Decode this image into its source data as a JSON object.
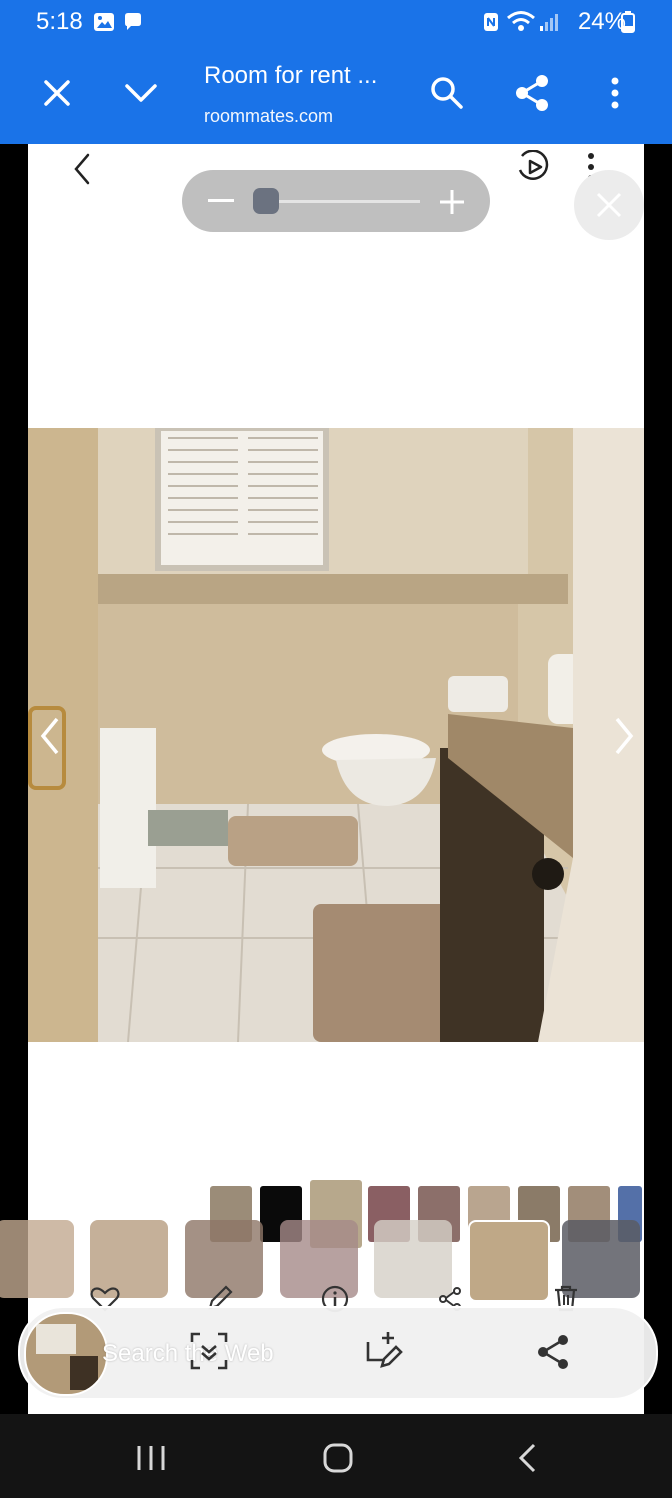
{
  "status_bar": {
    "time": "5:18",
    "battery": "24%"
  },
  "browser": {
    "title": "Room for rent ...",
    "url": "roommates.com"
  },
  "lens": {
    "search_placeholder": "Search the Web"
  },
  "colors": {
    "brand_blue": "#1a73e8",
    "viewer_bg": "#ffffff",
    "nav_bg": "#141414"
  },
  "icons": {
    "status_left": [
      "gallery-icon",
      "chat-icon"
    ],
    "status_right": [
      "nfc-icon",
      "wifi-icon",
      "signal-icon",
      "battery-icon"
    ],
    "browser": [
      "close-icon",
      "chevron-down-icon",
      "search-icon",
      "share-icon",
      "more-vert-icon"
    ],
    "viewer_top": [
      "back-icon",
      "motion-play-icon",
      "more-vert-icon",
      "zoom-out-icon",
      "zoom-in-icon",
      "close-icon"
    ],
    "gallery_actions": [
      "heart-icon",
      "edit-icon",
      "info-icon",
      "share-icon",
      "delete-icon"
    ],
    "lens_actions": [
      "scan-icon",
      "crop-edit-icon",
      "share-icon"
    ],
    "system_nav": [
      "recents-icon",
      "home-icon",
      "back-icon"
    ]
  }
}
